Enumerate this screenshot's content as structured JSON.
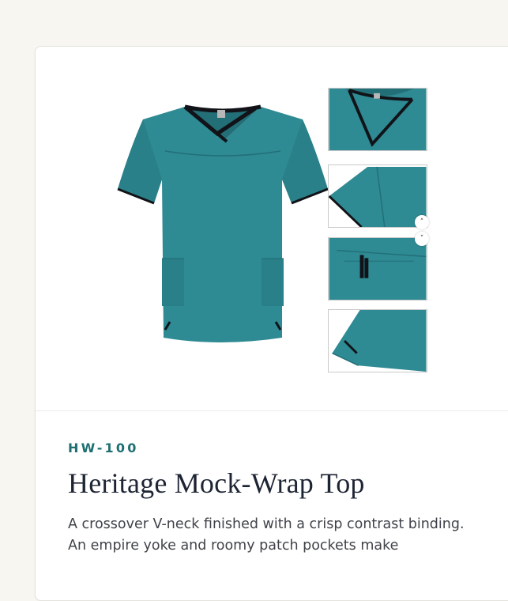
{
  "product": {
    "sku": "HW-100",
    "title": "Heritage Mock-Wrap Top",
    "description": "A crossover V-neck finished with a crisp contrast binding. An empire yoke and roomy patch pockets make"
  },
  "gallery": {
    "scroll_up_icon": "chevron-up-icon",
    "scroll_down_icon": "chevron-down-icon",
    "scroll_up_glyph": "˄",
    "scroll_down_glyph": "˅"
  },
  "colors": {
    "accent": "#1f6f72",
    "garment": "#2e8a93",
    "garment_shadow": "#236f77",
    "trim": "#111318",
    "page_bg": "#f7f6f1"
  }
}
